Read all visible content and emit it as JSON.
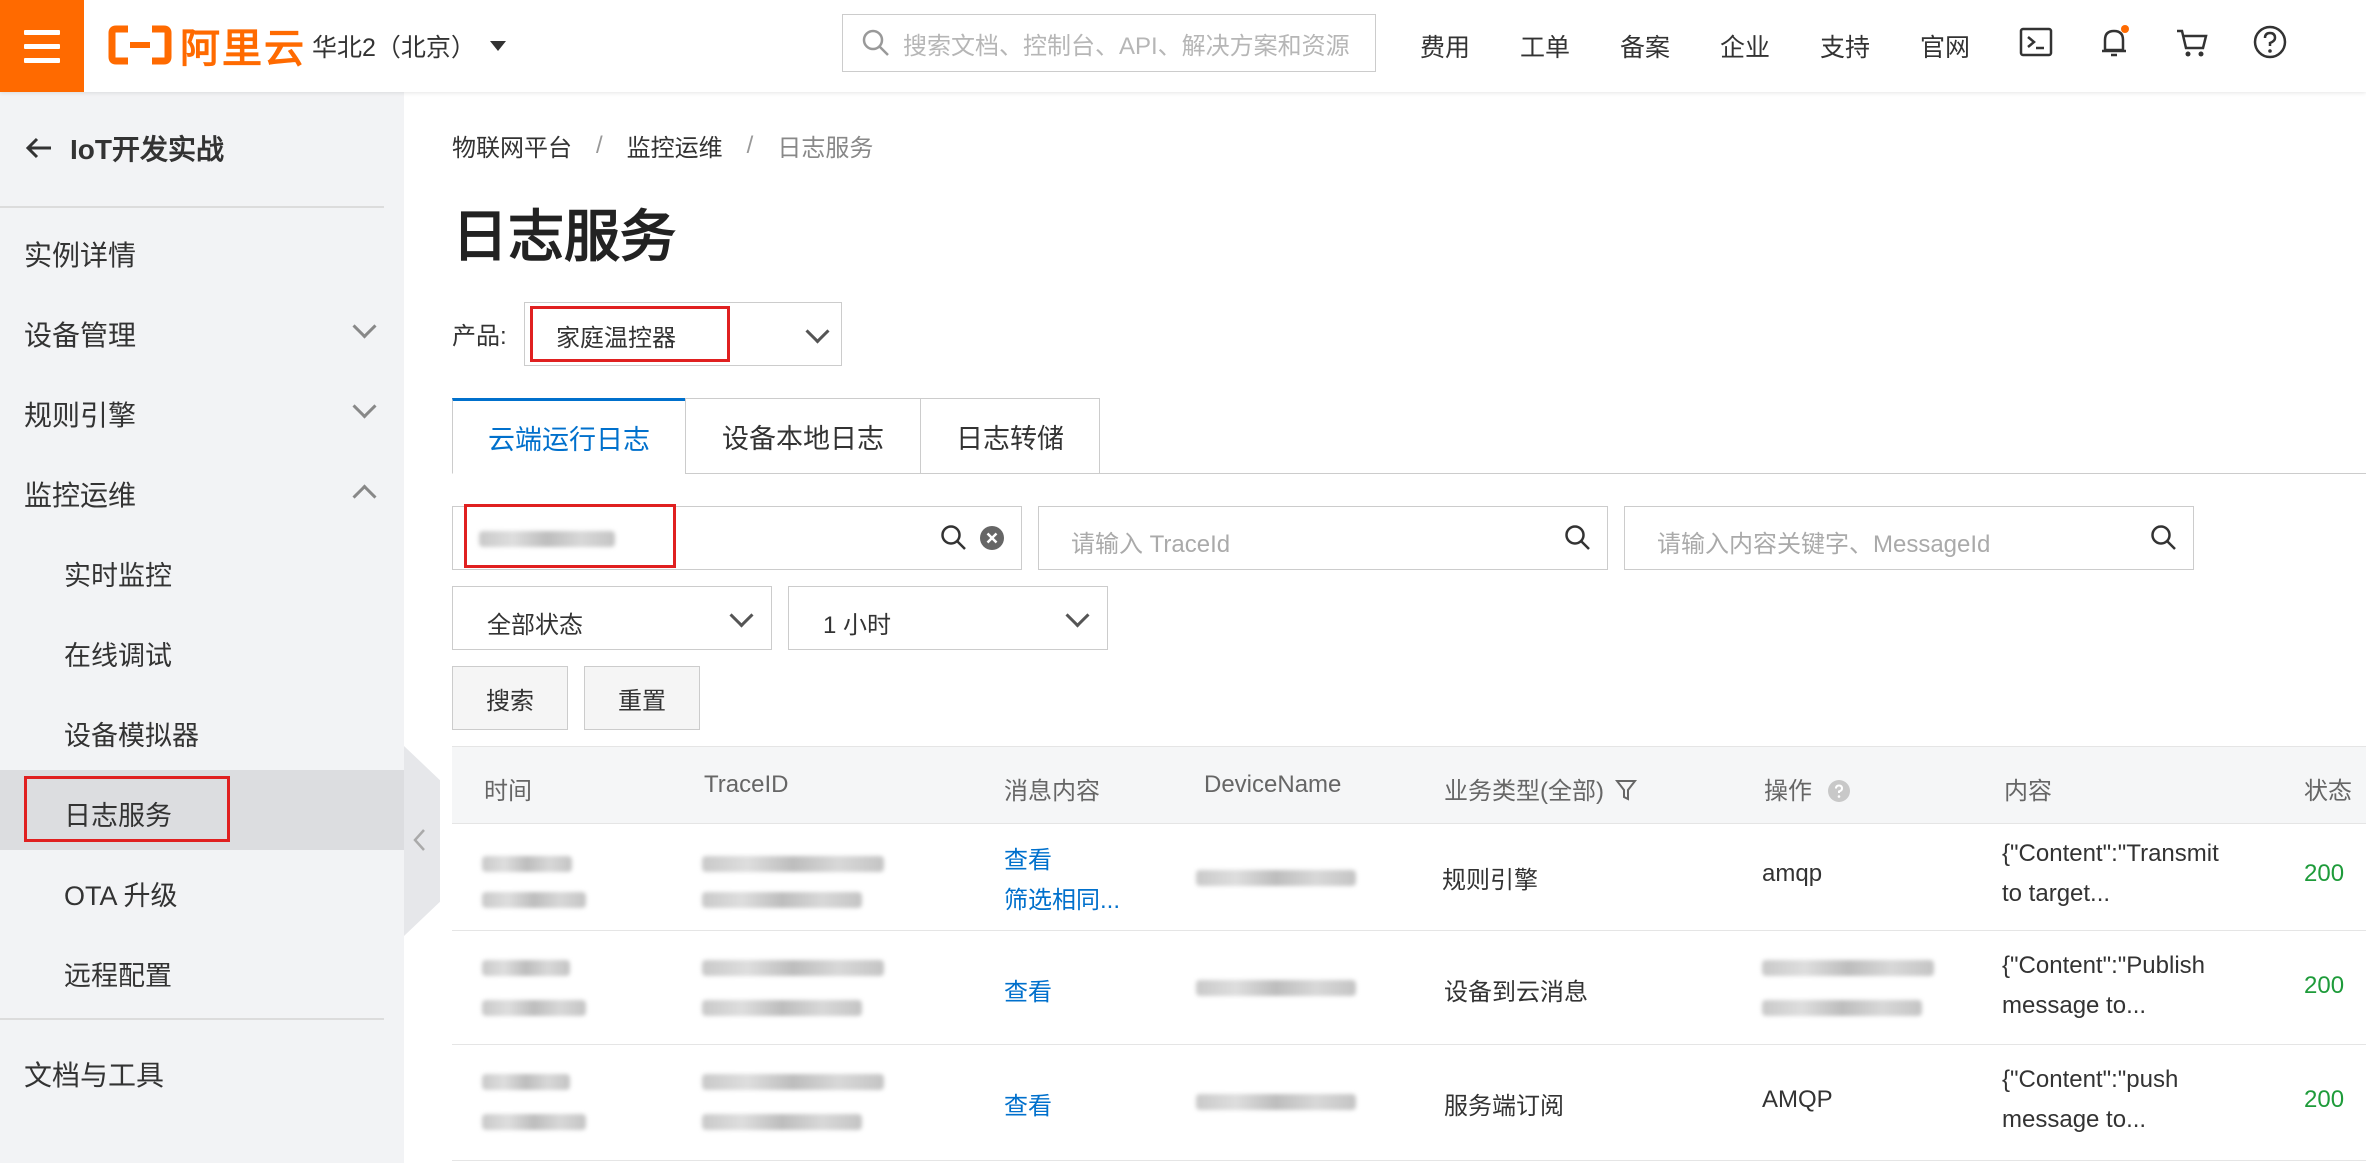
{
  "header": {
    "logo_text": "阿里云",
    "region": "华北2（北京）",
    "search_placeholder": "搜索文档、控制台、API、解决方案和资源",
    "nav_links": [
      "费用",
      "工单",
      "备案",
      "企业",
      "支持",
      "官网"
    ],
    "icons": [
      "terminal-icon",
      "bell-icon",
      "cart-icon",
      "help-icon"
    ],
    "accent_color": "#ff6a00"
  },
  "sidebar": {
    "back_label": "IoT开发实战",
    "items": [
      {
        "label": "实例详情"
      },
      {
        "label": "设备管理"
      },
      {
        "label": "规则引擎"
      },
      {
        "label": "监控运维"
      }
    ],
    "sub_items": [
      {
        "label": "实时监控"
      },
      {
        "label": "在线调试"
      },
      {
        "label": "设备模拟器"
      },
      {
        "label": "日志服务"
      },
      {
        "label": "OTA 升级"
      },
      {
        "label": "远程配置"
      }
    ],
    "footer_item": "文档与工具"
  },
  "breadcrumb": [
    "物联网平台",
    "监控运维",
    "日志服务"
  ],
  "breadcrumb_sep": "/",
  "page_title": "日志服务",
  "product": {
    "label": "产品:",
    "value": "家庭温控器"
  },
  "tabs": [
    "云端运行日志",
    "设备本地日志",
    "日志转储"
  ],
  "filters": {
    "traceid_placeholder": "请输入 TraceId",
    "keyword_placeholder": "请输入内容关键字、MessageId",
    "status_value": "全部状态",
    "time_value": "1 小时",
    "search_button": "搜索",
    "reset_button": "重置"
  },
  "table": {
    "columns": [
      "时间",
      "TraceID",
      "消息内容",
      "DeviceName",
      "业务类型(全部)",
      "操作",
      "内容",
      "状态"
    ],
    "rows": [
      {
        "links": [
          "查看",
          "筛选相同..."
        ],
        "biz_type": "规则引擎",
        "op": "amqp",
        "content": "{\"Content\":\"Transmit to target...",
        "status": "200"
      },
      {
        "links": [
          "查看"
        ],
        "biz_type": "设备到云消息",
        "op": "",
        "content": "{\"Content\":\"Publish message to...",
        "status": "200"
      },
      {
        "links": [
          "查看"
        ],
        "biz_type": "服务端订阅",
        "op": "AMQP",
        "content": "{\"Content\":\"push message to...",
        "status": "200"
      }
    ]
  }
}
